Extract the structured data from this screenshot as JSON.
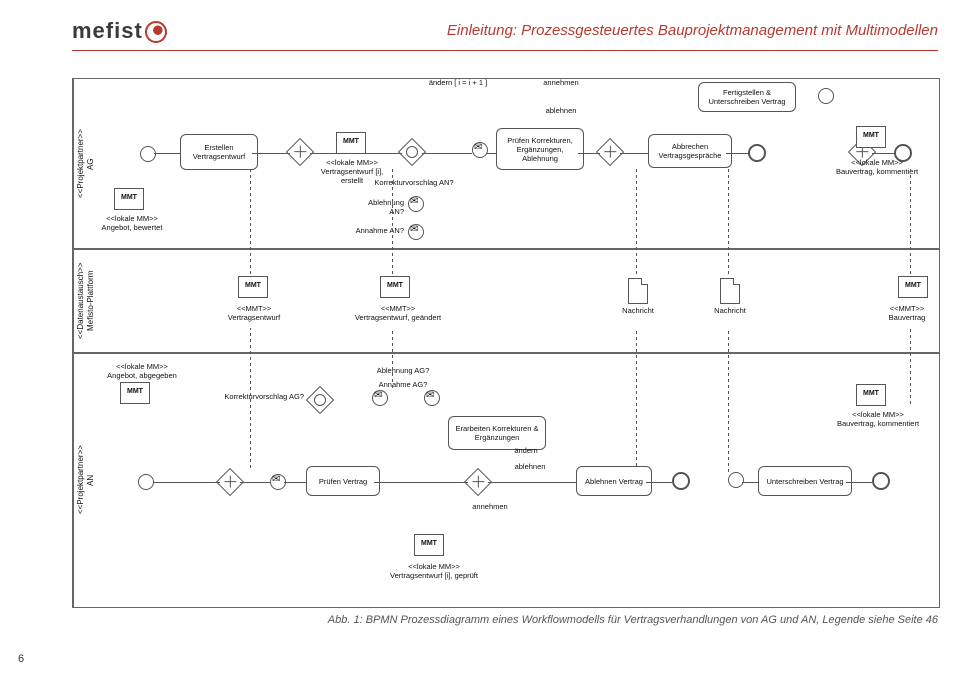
{
  "header": {
    "logo_text": "mefist",
    "title": "Einleitung: Prozessgesteuertes Bauprojektmanagement mit Multimodellen"
  },
  "page_number": "6",
  "caption": "Abb. 1: BPMN Prozessdiagramm eines Workflowmodells für Vertragsverhandlungen von AG und AN, Legende siehe Seite 46",
  "lanes": {
    "ag": "<<Projektpartner>>\nAG",
    "platform": "<<Datenaustausch>>\nMefisto-Plattform",
    "an": "<<Projektpartner>>\nAN"
  },
  "mmt_tag": "MMT",
  "ag": {
    "task_create": "Erstellen Vertragsentwurf",
    "task_check": "Prüfen Korrekturen, Ergänzungen, Ablehnung",
    "task_abort": "Abbrechen Vertragsgespräche",
    "task_sign": "Fertigstellen & Unterschreiben Vertrag",
    "d_offer": "<<lokale MM>>\nAngebot, bewertet",
    "d_draft": "<<lokale MM>>\nVertragsentwurf [i], erstellt",
    "d_contract": "<<lokale MM>>\nBauvertrag, kommentiert",
    "q_corr": "Korrekturvorschlag AN?",
    "q_reject": "Ablehnung AN?",
    "q_accept": "Annahme AN?",
    "edge_change": "ändern [ i = i + 1 ]",
    "edge_accept": "annehmen",
    "edge_reject": "ablehnen"
  },
  "platform": {
    "d_draft": "<<MMT>>\nVertragsentwurf",
    "d_draft_changed": "<<MMT>>\nVertragsentwurf, geändert",
    "d_msg": "Nachricht",
    "d_contract": "<<MMT>>\nBauvertrag"
  },
  "an": {
    "d_offer": "<<lokale MM>>\nAngebot, abgegeben",
    "task_check": "Prüfen Vertrag",
    "task_corr": "Erarbeiten Korrekturen & Ergänzungen",
    "task_reject": "Ablehnen Vertrag",
    "task_sign": "Unterschreiben Vertrag",
    "d_checked": "<<lokale MM>>\nVertragsentwurf [i], geprüft",
    "d_contract": "<<lokale MM>>\nBauvertrag, kommentiert",
    "q_corr": "Korrekturvorschlag AG?",
    "q_reject": "Ablehnung AG?",
    "q_accept": "Annahme AG?",
    "edge_reject": "ablehnen",
    "edge_change": "ändern",
    "edge_accept": "annehmen"
  }
}
